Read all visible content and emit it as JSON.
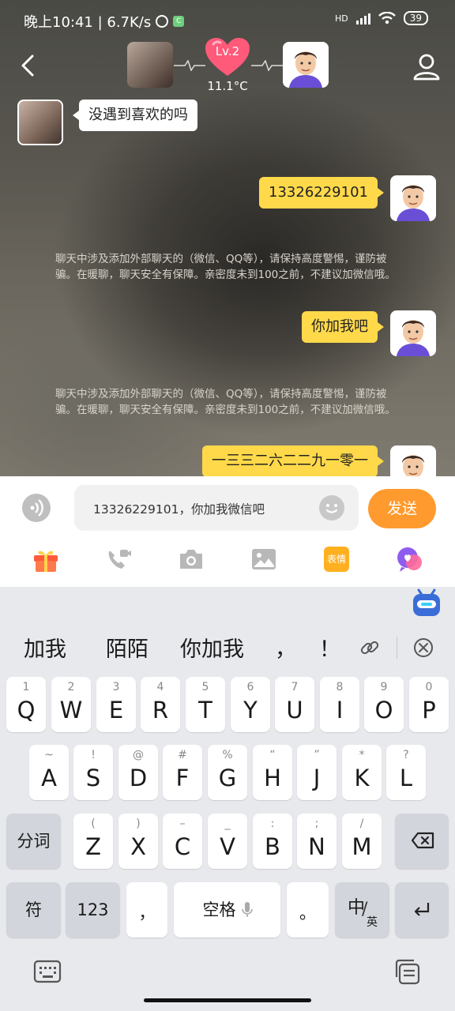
{
  "status_bar": {
    "time_speed": "晚上10:41 | 6.7K/s",
    "network_type": "HD",
    "battery": "39"
  },
  "header": {
    "level": "Lv.2",
    "temperature": "11.1°C"
  },
  "messages": {
    "incoming_1": "没遇到喜欢的吗",
    "outgoing_1": "13326229101",
    "notice_1": "聊天中涉及添加外部聊天的（微信、QQ等），请保持高度警惕，谨防被骗。在暖聊，聊天安全有保障。亲密度未到100之前，不建议加微信哦。",
    "outgoing_2": "你加我吧",
    "notice_2": "聊天中涉及添加外部聊天的（微信、QQ等），请保持高度警惕，谨防被骗。在暖聊，聊天安全有保障。亲密度未到100之前，不建议加微信哦。",
    "outgoing_3": "一三三二六二二九一零一"
  },
  "input": {
    "value": "13326229101，你加我微信吧",
    "send_label": "发送"
  },
  "toolbar": {
    "sticker_label": "表情"
  },
  "keyboard": {
    "suggestions": [
      "加我",
      "陌陌",
      "你加我",
      "，",
      "！"
    ],
    "row1": [
      {
        "main": "Q",
        "sub": "1"
      },
      {
        "main": "W",
        "sub": "2"
      },
      {
        "main": "E",
        "sub": "3"
      },
      {
        "main": "R",
        "sub": "4"
      },
      {
        "main": "T",
        "sub": "5"
      },
      {
        "main": "Y",
        "sub": "6"
      },
      {
        "main": "U",
        "sub": "7"
      },
      {
        "main": "I",
        "sub": "8"
      },
      {
        "main": "O",
        "sub": "9"
      },
      {
        "main": "P",
        "sub": "0"
      }
    ],
    "row2": [
      {
        "main": "A",
        "sub": "~"
      },
      {
        "main": "S",
        "sub": "!"
      },
      {
        "main": "D",
        "sub": "@"
      },
      {
        "main": "F",
        "sub": "#"
      },
      {
        "main": "G",
        "sub": "%"
      },
      {
        "main": "H",
        "sub": "“"
      },
      {
        "main": "J",
        "sub": "”"
      },
      {
        "main": "K",
        "sub": "*"
      },
      {
        "main": "L",
        "sub": "?"
      }
    ],
    "row3": [
      {
        "main": "Z",
        "sub": "("
      },
      {
        "main": "X",
        "sub": ")"
      },
      {
        "main": "C",
        "sub": "–"
      },
      {
        "main": "V",
        "sub": "_"
      },
      {
        "main": "B",
        "sub": ":"
      },
      {
        "main": "N",
        "sub": ";"
      },
      {
        "main": "M",
        "sub": "/"
      }
    ],
    "segment_label": "分词",
    "symbol_label": "符",
    "number_label": "123",
    "comma_label": "，",
    "space_label": "空格",
    "period_label": "。",
    "lang_zh": "中",
    "lang_en": "英"
  }
}
